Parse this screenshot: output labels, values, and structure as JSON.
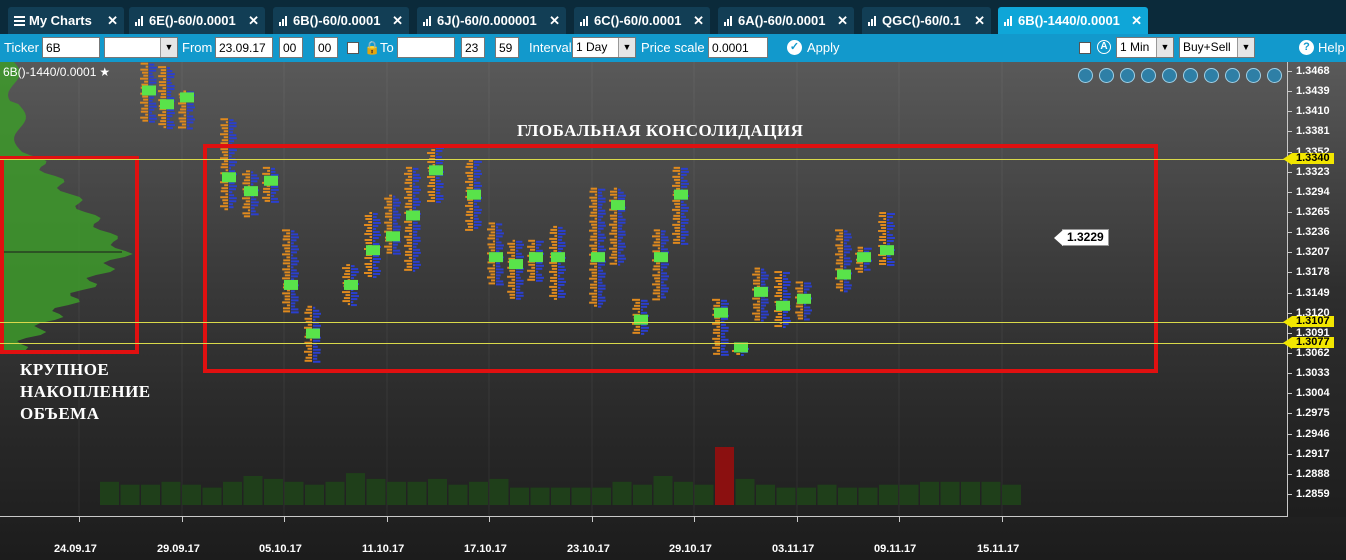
{
  "tabs": [
    {
      "label": "My Charts",
      "icon": "menu-icon"
    },
    {
      "label": "6E()-60/0.0001",
      "icon": "bar-chart-icon"
    },
    {
      "label": "6B()-60/0.0001",
      "icon": "bar-chart-icon"
    },
    {
      "label": "6J()-60/0.000001",
      "icon": "bar-chart-icon"
    },
    {
      "label": "6C()-60/0.0001",
      "icon": "bar-chart-icon"
    },
    {
      "label": "6A()-60/0.0001",
      "icon": "bar-chart-icon"
    },
    {
      "label": "QGC()-60/0.1",
      "icon": "bar-chart-icon"
    },
    {
      "label": "6B()-1440/0.0001",
      "icon": "bar-chart-icon",
      "active": true
    }
  ],
  "toolbar": {
    "ticker_label": "Ticker",
    "ticker_value": "6B",
    "ticker_select_value": "",
    "from_label": "From",
    "from_date": "23.09.17",
    "from_hour": "00",
    "from_min": "00",
    "to_label": "To",
    "to_date": "",
    "to_hour": "23",
    "to_min": "59",
    "interval_label": "Interval",
    "interval_value": "1 Day",
    "price_scale_label": "Price scale",
    "price_scale_value": "0.0001",
    "apply_label": "Apply",
    "timeframe_value": "1 Min",
    "side_value": "Buy+Sell",
    "help_label": "Help"
  },
  "chart": {
    "title": "6B()-1440/0.0001",
    "annotation_consolidation": "ГЛОБАЛЬНАЯ КОНСОЛИДАЦИЯ",
    "annotation_volume_line1": "КРУПНОЕ",
    "annotation_volume_line2": "НАКОПЛЕНИЕ",
    "annotation_volume_line3": "ОБЪЕМА",
    "last_price": "1.3229",
    "level_prices": [
      "1.3340",
      "1.3107",
      "1.3077"
    ],
    "price_ticks": [
      "1.3468",
      "1.3439",
      "1.3410",
      "1.3381",
      "1.3352",
      "1.3323",
      "1.3294",
      "1.3265",
      "1.3236",
      "1.3207",
      "1.3178",
      "1.3149",
      "1.3120",
      "1.3091",
      "1.3062",
      "1.3033",
      "1.3004",
      "1.2975",
      "1.2946",
      "1.2917",
      "1.2888",
      "1.2859"
    ],
    "date_ticks": [
      "24.09.17",
      "29.09.17",
      "05.10.17",
      "11.10.17",
      "17.10.17",
      "23.10.17",
      "29.10.17",
      "03.11.17",
      "09.11.17",
      "15.11.17"
    ],
    "colors": {
      "levels": "#f2e600",
      "boxes": "#e01010",
      "bid": "#e08a1e",
      "ask": "#2a3fd0",
      "poc": "#59e34a",
      "volume": "#1f3f1a",
      "volume_spike": "#8b1010"
    }
  },
  "chart_data": {
    "type": "bar",
    "title": "6B()-1440/0.0001",
    "ylim": [
      1.2845,
      1.348
    ],
    "y_ticks": [
      1.3468,
      1.3439,
      1.341,
      1.3381,
      1.3352,
      1.3323,
      1.3294,
      1.3265,
      1.3236,
      1.3207,
      1.3178,
      1.3149,
      1.312,
      1.3091,
      1.3062,
      1.3033,
      1.3004,
      1.2975,
      1.2946,
      1.2917,
      1.2888,
      1.2859
    ],
    "horizontal_levels": [
      1.334,
      1.3107,
      1.3077
    ],
    "last_price": 1.3229,
    "candles": [
      {
        "high": 1.348,
        "low": 1.3395,
        "poc": 1.344
      },
      {
        "high": 1.3475,
        "low": 1.3385,
        "poc": 1.342
      },
      {
        "high": 1.344,
        "low": 1.3385,
        "poc": 1.343
      },
      {
        "high": 1.34,
        "low": 1.327,
        "poc": 1.3315
      },
      {
        "high": 1.3325,
        "low": 1.326,
        "poc": 1.3295
      },
      {
        "high": 1.333,
        "low": 1.328,
        "poc": 1.331
      },
      {
        "high": 1.324,
        "low": 1.312,
        "poc": 1.316
      },
      {
        "high": 1.313,
        "low": 1.305,
        "poc": 1.309
      },
      {
        "high": 1.319,
        "low": 1.313,
        "poc": 1.316
      },
      {
        "high": 1.3265,
        "low": 1.317,
        "poc": 1.321
      },
      {
        "high": 1.329,
        "low": 1.3205,
        "poc": 1.323
      },
      {
        "high": 1.333,
        "low": 1.318,
        "poc": 1.326
      },
      {
        "high": 1.336,
        "low": 1.328,
        "poc": 1.3325
      },
      {
        "high": 1.334,
        "low": 1.324,
        "poc": 1.329
      },
      {
        "high": 1.325,
        "low": 1.316,
        "poc": 1.32
      },
      {
        "high": 1.3225,
        "low": 1.314,
        "poc": 1.319
      },
      {
        "high": 1.3225,
        "low": 1.3165,
        "poc": 1.32
      },
      {
        "high": 1.3245,
        "low": 1.314,
        "poc": 1.32
      },
      {
        "high": 1.33,
        "low": 1.313,
        "poc": 1.32
      },
      {
        "high": 1.33,
        "low": 1.319,
        "poc": 1.3275
      },
      {
        "high": 1.314,
        "low": 1.309,
        "poc": 1.311
      },
      {
        "high": 1.324,
        "low": 1.314,
        "poc": 1.32
      },
      {
        "high": 1.333,
        "low": 1.322,
        "poc": 1.329
      },
      {
        "high": 1.314,
        "low": 1.306,
        "poc": 1.312
      },
      {
        "high": 1.3075,
        "low": 1.306,
        "poc": 1.307
      },
      {
        "high": 1.3185,
        "low": 1.311,
        "poc": 1.315
      },
      {
        "high": 1.318,
        "low": 1.31,
        "poc": 1.313
      },
      {
        "high": 1.3165,
        "low": 1.311,
        "poc": 1.314
      },
      {
        "high": 1.324,
        "low": 1.315,
        "poc": 1.3175
      },
      {
        "high": 1.3215,
        "low": 1.318,
        "poc": 1.32
      },
      {
        "high": 1.3265,
        "low": 1.319,
        "poc": 1.321
      }
    ],
    "volume": [
      0.4,
      0.35,
      0.35,
      0.4,
      0.35,
      0.3,
      0.4,
      0.5,
      0.45,
      0.4,
      0.35,
      0.4,
      0.55,
      0.45,
      0.4,
      0.4,
      0.45,
      0.35,
      0.4,
      0.45,
      0.3,
      0.3,
      0.3,
      0.3,
      0.3,
      0.4,
      0.35,
      0.5,
      0.4,
      0.35,
      1.0,
      0.45,
      0.35,
      0.3,
      0.3,
      0.35,
      0.3,
      0.3,
      0.35,
      0.35,
      0.4,
      0.4,
      0.4,
      0.4,
      0.35
    ],
    "volume_spike_index": 30
  }
}
